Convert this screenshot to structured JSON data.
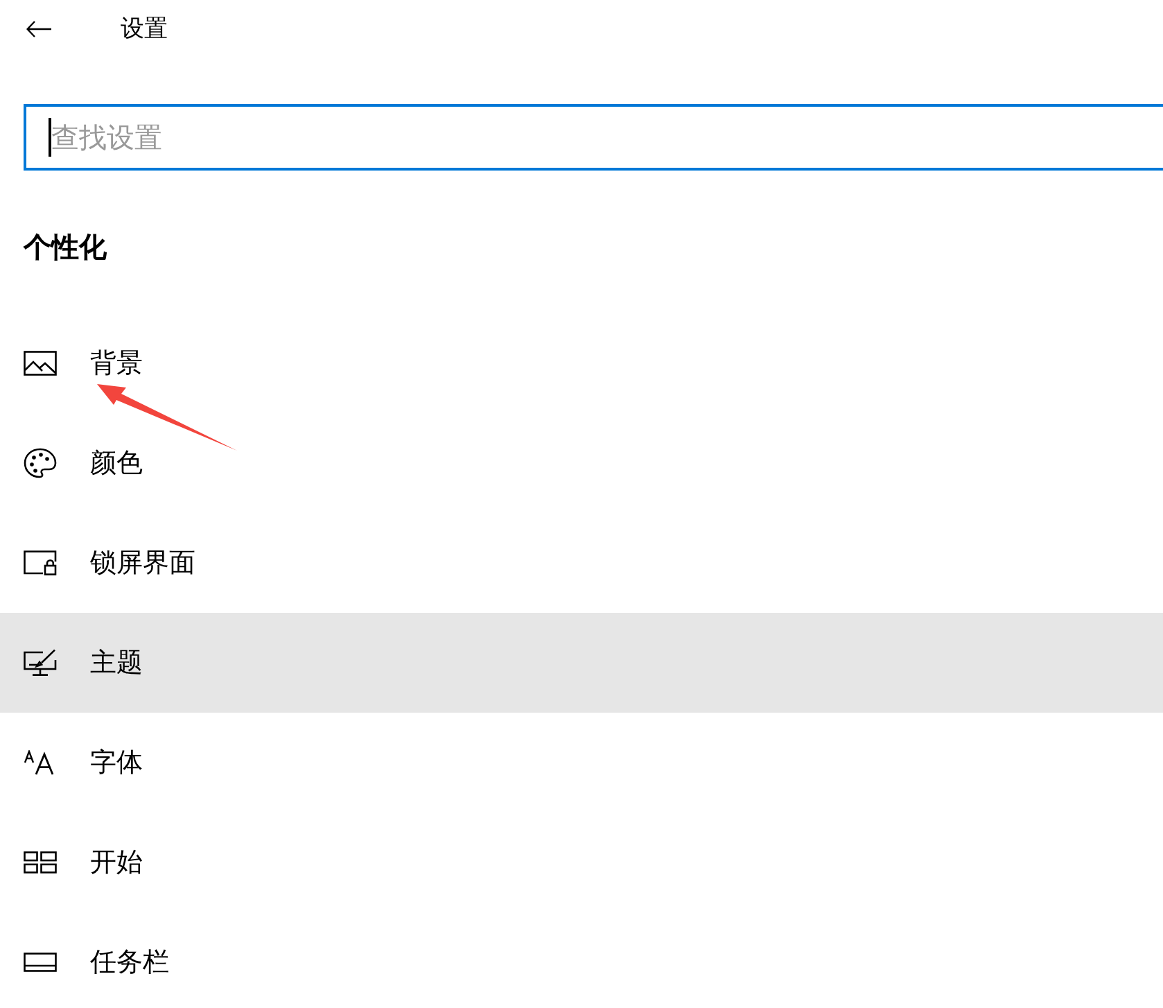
{
  "header": {
    "title": "设置"
  },
  "search": {
    "placeholder": "查找设置",
    "focused": true
  },
  "section": {
    "title": "个性化"
  },
  "nav_items": [
    {
      "label": "背景",
      "selected": false,
      "annotated": true
    },
    {
      "label": "颜色",
      "selected": false,
      "annotated": false
    },
    {
      "label": "锁屏界面",
      "selected": false,
      "annotated": false
    },
    {
      "label": "主题",
      "selected": true,
      "annotated": false
    },
    {
      "label": "字体",
      "selected": false,
      "annotated": false
    },
    {
      "label": "开始",
      "selected": false,
      "annotated": false
    },
    {
      "label": "任务栏",
      "selected": false,
      "annotated": false
    }
  ]
}
